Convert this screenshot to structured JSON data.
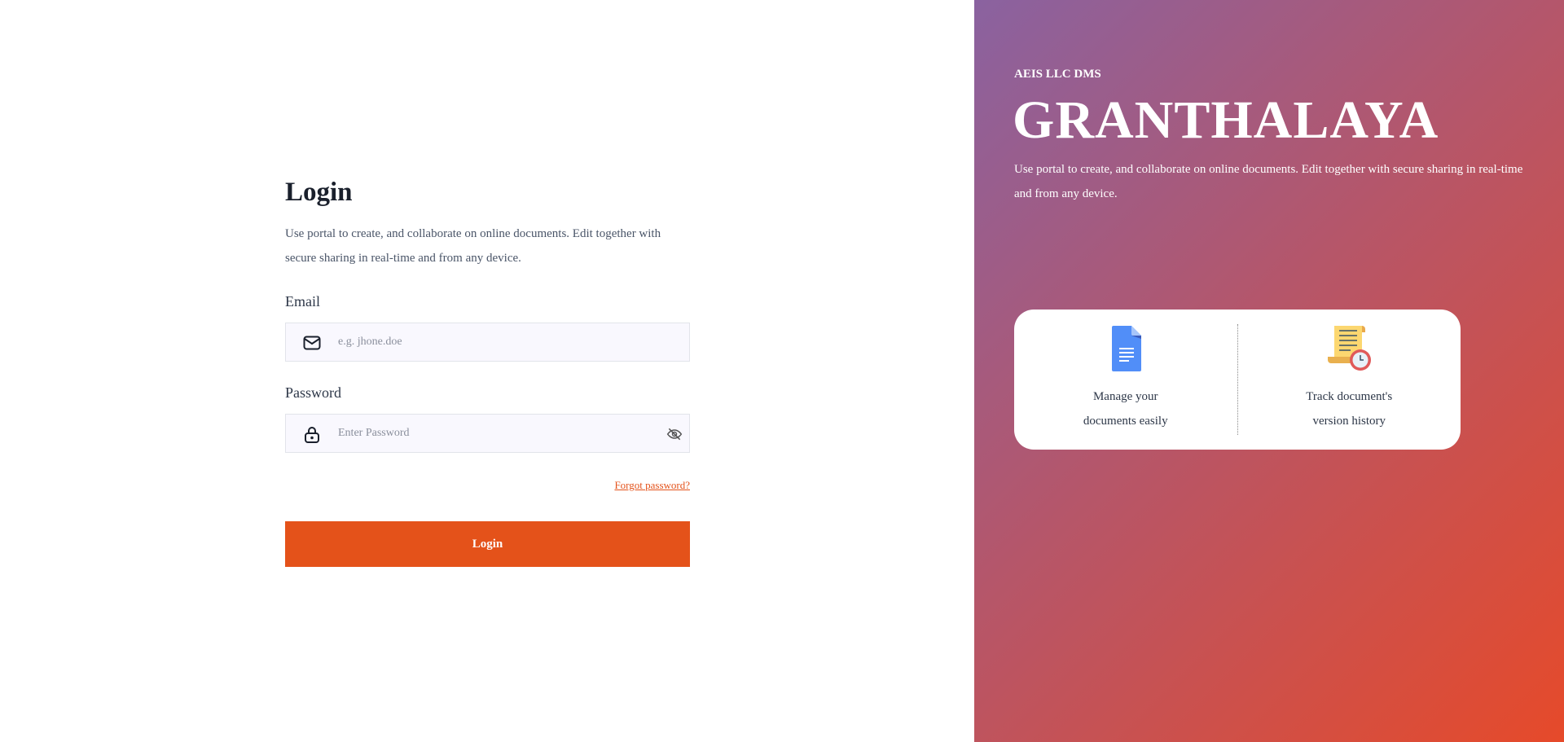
{
  "login": {
    "title": "Login",
    "description": "Use portal to create, and collaborate on online documents. Edit together with secure sharing in real-time and from any device.",
    "email_label": "Email",
    "email_placeholder": "e.g. jhone.doe",
    "password_label": "Password",
    "password_placeholder": "Enter Password",
    "forgot_link": "Forgot password?",
    "submit_label": "Login"
  },
  "brand": {
    "company": "AEIS LLC DMS",
    "name": "GRANTHALAYA",
    "description": "Use portal to create, and collaborate on online documents. Edit together with secure sharing in real-time and from any device.",
    "features": [
      {
        "icon": "document-icon",
        "label": "Manage your documents easily"
      },
      {
        "icon": "version-history-icon",
        "label": "Track document's version history"
      }
    ]
  },
  "colors": {
    "accent": "#e4521a",
    "gradient_start": "#8a62a0",
    "gradient_end": "#e64a2a"
  }
}
